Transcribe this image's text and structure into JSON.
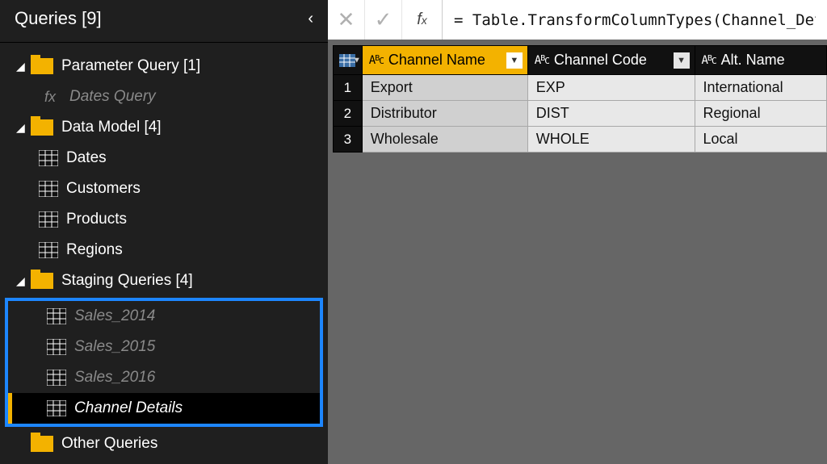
{
  "sidebar": {
    "title": "Queries [9]",
    "groups": [
      {
        "label": "Parameter Query [1]"
      },
      {
        "label": "Data Model [4]"
      },
      {
        "label": "Staging Queries [4]"
      },
      {
        "label": "Other Queries"
      }
    ],
    "items": {
      "dates_query": "Dates Query",
      "dates": "Dates",
      "customers": "Customers",
      "products": "Products",
      "regions": "Regions",
      "sales_2014": "Sales_2014",
      "sales_2015": "Sales_2015",
      "sales_2016": "Sales_2016",
      "channel_details": "Channel Details"
    }
  },
  "formula": "= Table.TransformColumnTypes(Channel_Deta",
  "columns": [
    {
      "label": "Channel Name",
      "selected": true
    },
    {
      "label": "Channel Code",
      "selected": false
    },
    {
      "label": "Alt. Name",
      "selected": false
    }
  ],
  "rows": [
    {
      "n": "1",
      "name": "Export",
      "code": "EXP",
      "alt": "International"
    },
    {
      "n": "2",
      "name": "Distributor",
      "code": "DIST",
      "alt": "Regional"
    },
    {
      "n": "3",
      "name": "Wholesale",
      "code": "WHOLE",
      "alt": "Local"
    }
  ]
}
